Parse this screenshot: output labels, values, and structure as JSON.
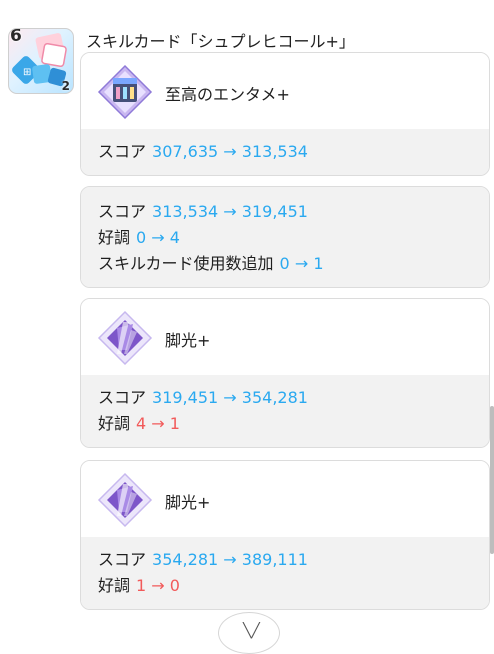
{
  "skill_card": {
    "title": "スキルカード「シュプレヒコール+」",
    "cost": "6",
    "plus_mark": "2"
  },
  "items": [
    {
      "name": "至高のエンタメ+",
      "icon": "drink-item-icon",
      "rows": [
        {
          "label": "スコア",
          "from": "307,635",
          "to": "313,534",
          "color": "blue"
        }
      ]
    },
    {
      "name": "",
      "icon": "",
      "rows": [
        {
          "label": "スコア",
          "from": "313,534",
          "to": "319,451",
          "color": "blue"
        },
        {
          "label": "好調",
          "from": "0",
          "to": "4",
          "color": "blue"
        },
        {
          "label": "スキルカード使用数追加",
          "from": "0",
          "to": "1",
          "color": "blue"
        }
      ]
    },
    {
      "name": "脚光+",
      "icon": "spotlight-card-icon",
      "rows": [
        {
          "label": "スコア",
          "from": "319,451",
          "to": "354,281",
          "color": "blue"
        },
        {
          "label": "好調",
          "from": "4",
          "to": "1",
          "color": "red"
        }
      ]
    },
    {
      "name": "脚光+",
      "icon": "spotlight-card-icon",
      "rows": [
        {
          "label": "スコア",
          "from": "354,281",
          "to": "389,111",
          "color": "blue"
        },
        {
          "label": "好調",
          "from": "1",
          "to": "0",
          "color": "red"
        }
      ]
    }
  ],
  "arrow": "→",
  "colors": {
    "increase": "#2aa9f0",
    "decrease": "#f25a5a",
    "panel": "#f2f2f2",
    "border": "#dcdcdc"
  },
  "expand_control": {
    "icon": "chevron-down-icon"
  }
}
